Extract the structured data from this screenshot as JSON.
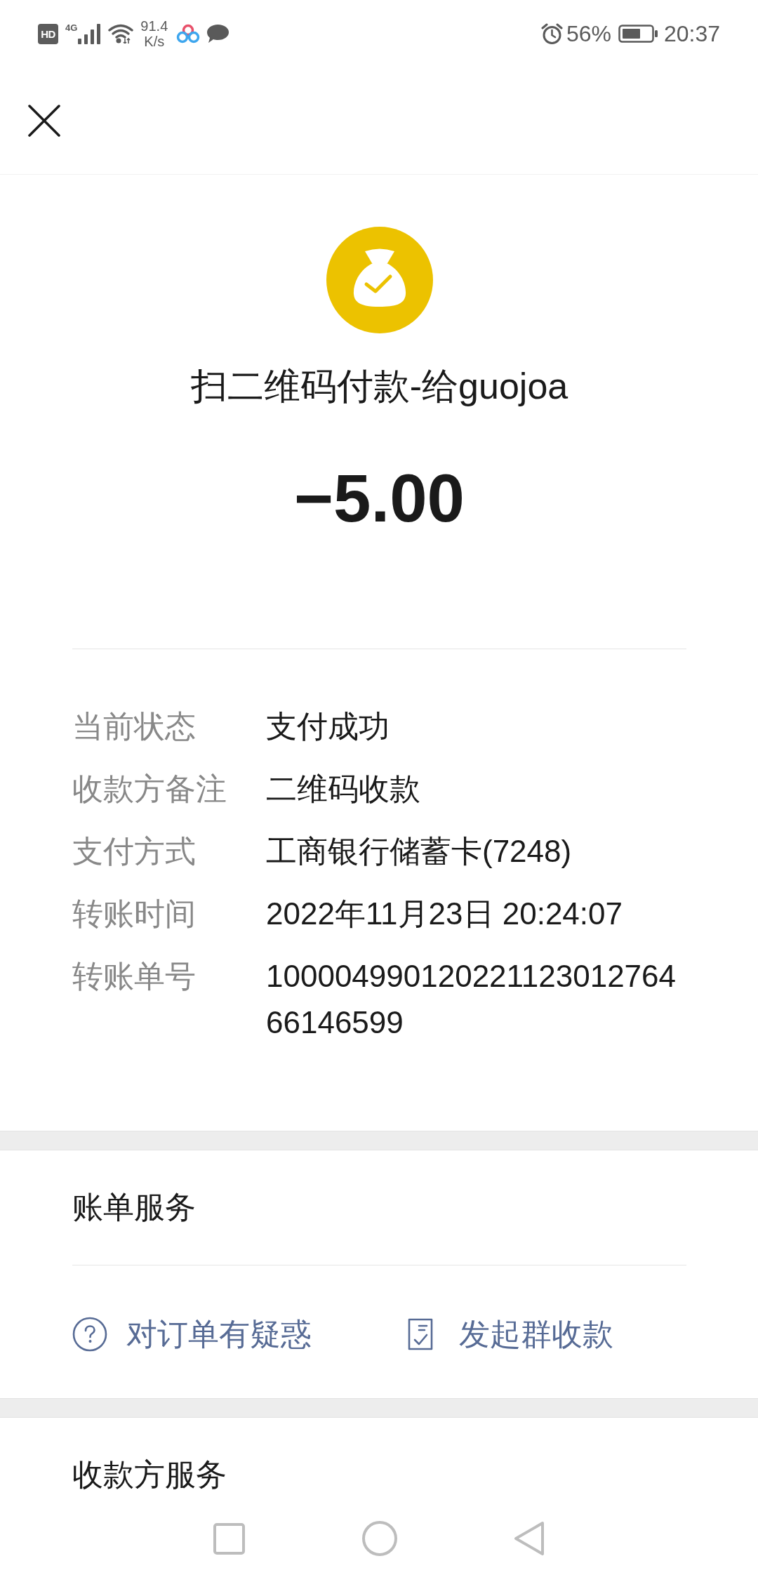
{
  "status_bar": {
    "hd": "HD",
    "network": "4G",
    "speed_value": "91.4",
    "speed_unit": "K/s",
    "battery": "56%",
    "time": "20:37"
  },
  "payment": {
    "title": "扫二维码付款-给guojoa",
    "amount": "−5.00"
  },
  "details": [
    {
      "label": "当前状态",
      "value": "支付成功"
    },
    {
      "label": "收款方备注",
      "value": "二维码收款"
    },
    {
      "label": "支付方式",
      "value": "工商银行储蓄卡(7248)"
    },
    {
      "label": "转账时间",
      "value": "2022年11月23日 20:24:07"
    },
    {
      "label": "转账单号",
      "value": "10000499012022112301276466146599"
    }
  ],
  "bill_services": {
    "title": "账单服务",
    "actions": [
      {
        "kind": "help",
        "label": "对订单有疑惑"
      },
      {
        "kind": "receipt",
        "label": "发起群收款"
      }
    ]
  },
  "payee_services": {
    "title": "收款方服务"
  }
}
